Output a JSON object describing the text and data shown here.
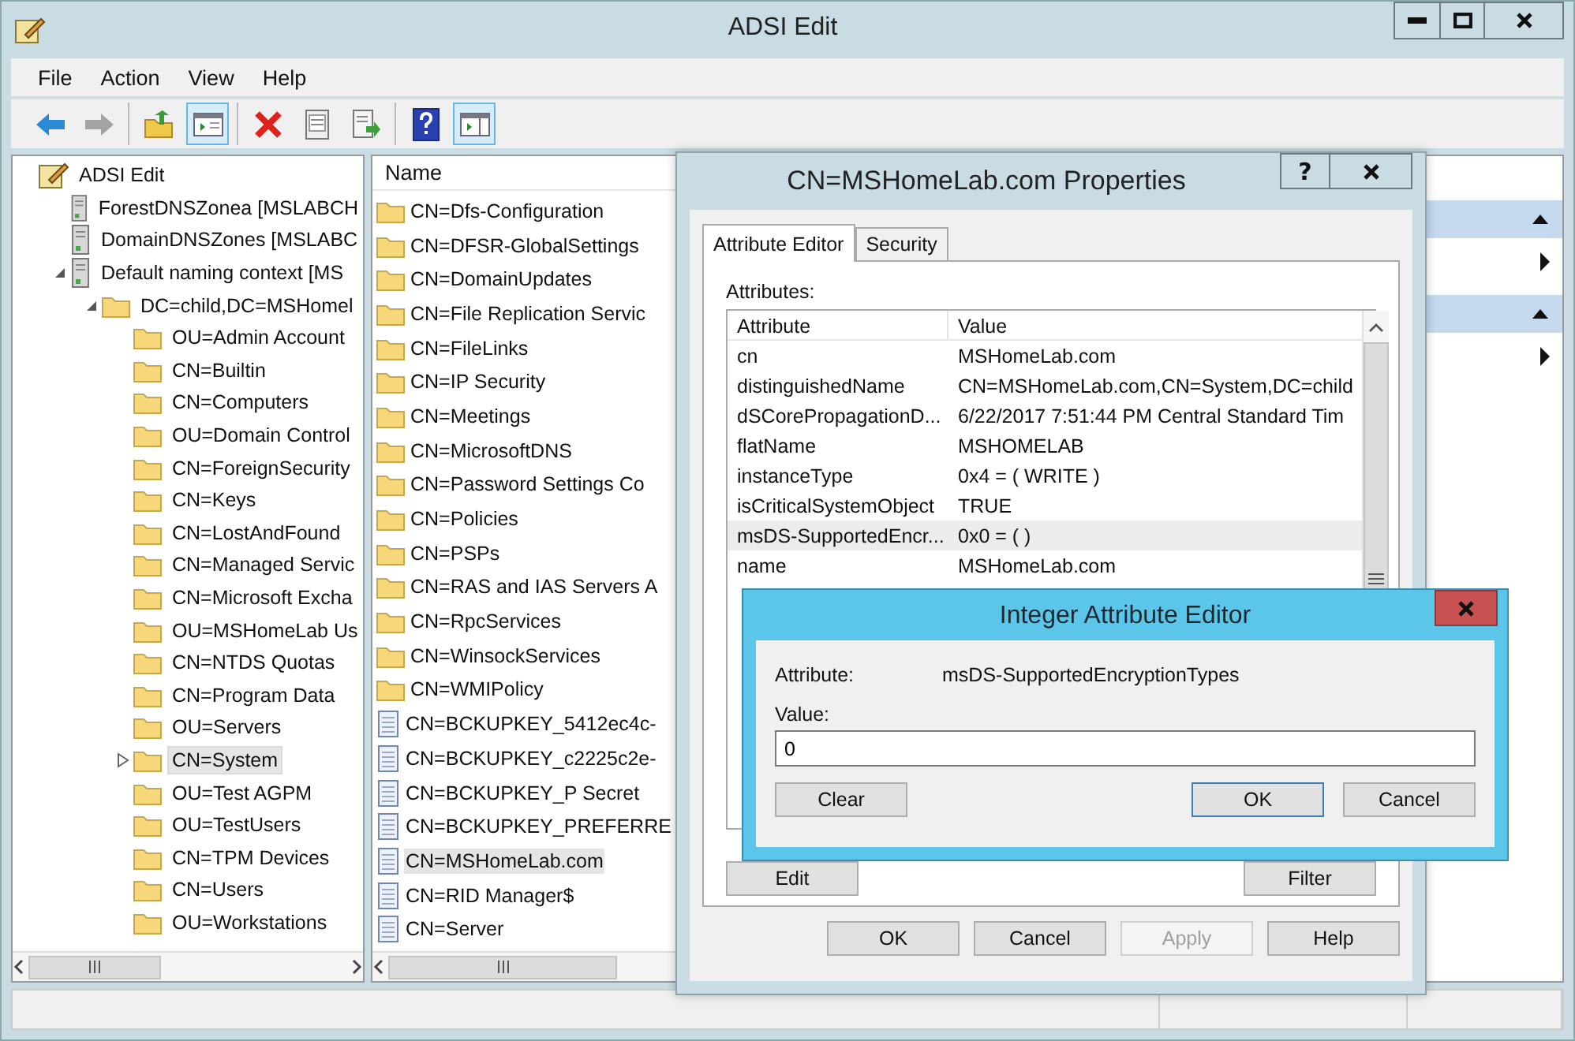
{
  "window": {
    "title": "ADSI Edit"
  },
  "menu": [
    "File",
    "Action",
    "View",
    "Help"
  ],
  "toolbar": [
    [
      {
        "kind": "back",
        "selected": false,
        "disabled": false
      },
      {
        "kind": "forward",
        "selected": false,
        "disabled": true
      }
    ],
    [
      {
        "kind": "up",
        "selected": false,
        "disabled": false
      },
      {
        "kind": "tree",
        "selected": true,
        "disabled": false
      }
    ],
    [
      {
        "kind": "delete",
        "selected": false,
        "disabled": false
      },
      {
        "kind": "properties",
        "selected": false,
        "disabled": false
      },
      {
        "kind": "export",
        "selected": false,
        "disabled": false
      }
    ],
    [
      {
        "kind": "help",
        "selected": false,
        "disabled": false
      },
      {
        "kind": "actionpane",
        "selected": true,
        "disabled": false
      }
    ]
  ],
  "tree": [
    {
      "label": "ADSI Edit",
      "kind": "app",
      "selected": false,
      "children": [
        {
          "label": "ForestDNSZonea [MSLABCH",
          "kind": "server",
          "selected": false
        },
        {
          "label": "DomainDNSZones [MSLABC",
          "kind": "server",
          "selected": false
        },
        {
          "label": "Default naming context [MS",
          "kind": "server",
          "expanded": true,
          "selected": false,
          "children": [
            {
              "label": "DC=child,DC=MSHomel",
              "kind": "folder",
              "expanded": true,
              "selected": false,
              "children": [
                {
                  "label": "OU=Admin Account",
                  "kind": "folder",
                  "selected": false
                },
                {
                  "label": "CN=Builtin",
                  "kind": "folder",
                  "selected": false
                },
                {
                  "label": "CN=Computers",
                  "kind": "folder",
                  "selected": false
                },
                {
                  "label": "OU=Domain Control",
                  "kind": "folder",
                  "selected": false
                },
                {
                  "label": "CN=ForeignSecurity",
                  "kind": "folder",
                  "selected": false
                },
                {
                  "label": "CN=Keys",
                  "kind": "folder",
                  "selected": false
                },
                {
                  "label": "CN=LostAndFound",
                  "kind": "folder",
                  "selected": false
                },
                {
                  "label": "CN=Managed Servic",
                  "kind": "folder",
                  "selected": false
                },
                {
                  "label": "CN=Microsoft Excha",
                  "kind": "folder",
                  "selected": false
                },
                {
                  "label": "OU=MSHomeLab Us",
                  "kind": "folder",
                  "selected": false
                },
                {
                  "label": "CN=NTDS Quotas",
                  "kind": "folder",
                  "selected": false
                },
                {
                  "label": "CN=Program Data",
                  "kind": "folder",
                  "selected": false
                },
                {
                  "label": "OU=Servers",
                  "kind": "folder",
                  "selected": false
                },
                {
                  "label": "CN=System",
                  "kind": "folder",
                  "expanded": false,
                  "selected": true
                },
                {
                  "label": "OU=Test AGPM",
                  "kind": "folder",
                  "selected": false
                },
                {
                  "label": "OU=TestUsers",
                  "kind": "folder",
                  "selected": false
                },
                {
                  "label": "CN=TPM Devices",
                  "kind": "folder",
                  "selected": false
                },
                {
                  "label": "CN=Users",
                  "kind": "folder",
                  "selected": false
                },
                {
                  "label": "OU=Workstations",
                  "kind": "folder",
                  "selected": false
                }
              ]
            }
          ]
        }
      ]
    }
  ],
  "list": {
    "header": "Name",
    "items": [
      {
        "label": "CN=Dfs-Configuration",
        "kind": "folder",
        "selected": false
      },
      {
        "label": "CN=DFSR-GlobalSettings",
        "kind": "folder",
        "selected": false
      },
      {
        "label": "CN=DomainUpdates",
        "kind": "folder",
        "selected": false
      },
      {
        "label": "CN=File Replication Servic",
        "kind": "folder",
        "selected": false
      },
      {
        "label": "CN=FileLinks",
        "kind": "folder",
        "selected": false
      },
      {
        "label": "CN=IP Security",
        "kind": "folder",
        "selected": false
      },
      {
        "label": "CN=Meetings",
        "kind": "folder",
        "selected": false
      },
      {
        "label": "CN=MicrosoftDNS",
        "kind": "folder",
        "selected": false
      },
      {
        "label": "CN=Password Settings Co",
        "kind": "folder",
        "selected": false
      },
      {
        "label": "CN=Policies",
        "kind": "folder",
        "selected": false
      },
      {
        "label": "CN=PSPs",
        "kind": "folder",
        "selected": false
      },
      {
        "label": "CN=RAS and IAS Servers A",
        "kind": "folder",
        "selected": false
      },
      {
        "label": "CN=RpcServices",
        "kind": "folder",
        "selected": false
      },
      {
        "label": "CN=WinsockServices",
        "kind": "folder",
        "selected": false
      },
      {
        "label": "CN=WMIPolicy",
        "kind": "folder",
        "selected": false
      },
      {
        "label": "CN=BCKUPKEY_5412ec4c-",
        "kind": "record",
        "selected": false
      },
      {
        "label": "CN=BCKUPKEY_c2225c2e-",
        "kind": "record",
        "selected": false
      },
      {
        "label": "CN=BCKUPKEY_P Secret",
        "kind": "record",
        "selected": false
      },
      {
        "label": "CN=BCKUPKEY_PREFERRE",
        "kind": "record",
        "selected": false
      },
      {
        "label": "CN=MSHomeLab.com",
        "kind": "record",
        "selected": true
      },
      {
        "label": "CN=RID Manager$",
        "kind": "record",
        "selected": false
      },
      {
        "label": "CN=Server",
        "kind": "record",
        "selected": false
      }
    ]
  },
  "actions_pane": {
    "sections": [
      {
        "expanded": true
      },
      {
        "expanded": true
      }
    ]
  },
  "properties_dialog": {
    "title": "CN=MSHomeLab.com Properties",
    "help_button": "?",
    "tabs": [
      {
        "label": "Attribute Editor",
        "selected": true
      },
      {
        "label": "Security",
        "selected": false
      }
    ],
    "attributes_label": "Attributes:",
    "columns": [
      "Attribute",
      "Value"
    ],
    "rows": [
      {
        "attribute": "cn",
        "value": "MSHomeLab.com",
        "selected": false
      },
      {
        "attribute": "distinguishedName",
        "value": "CN=MSHomeLab.com,CN=System,DC=child",
        "selected": false
      },
      {
        "attribute": "dSCorePropagationD...",
        "value": "6/22/2017 7:51:44 PM Central Standard Tim",
        "selected": false
      },
      {
        "attribute": "flatName",
        "value": "MSHOMELAB",
        "selected": false
      },
      {
        "attribute": "instanceType",
        "value": "0x4 = ( WRITE )",
        "selected": false
      },
      {
        "attribute": "isCriticalSystemObject",
        "value": "TRUE",
        "selected": false
      },
      {
        "attribute": "msDS-SupportedEncr...",
        "value": "0x0 = (  )",
        "selected": true
      },
      {
        "attribute": "name",
        "value": "MSHomeLab.com",
        "selected": false
      }
    ],
    "side_buttons": [
      "Edit",
      "Filter"
    ],
    "buttons": [
      {
        "label": "OK",
        "disabled": false
      },
      {
        "label": "Cancel",
        "disabled": false
      },
      {
        "label": "Apply",
        "disabled": true
      },
      {
        "label": "Help",
        "disabled": false
      }
    ]
  },
  "integer_editor": {
    "title": "Integer Attribute Editor",
    "attribute_label": "Attribute:",
    "attribute_value": "msDS-SupportedEncryptionTypes",
    "value_label": "Value:",
    "value": "0",
    "buttons": [
      {
        "label": "Clear",
        "default": false
      },
      {
        "label": "OK",
        "default": true
      },
      {
        "label": "Cancel",
        "default": false
      }
    ]
  }
}
